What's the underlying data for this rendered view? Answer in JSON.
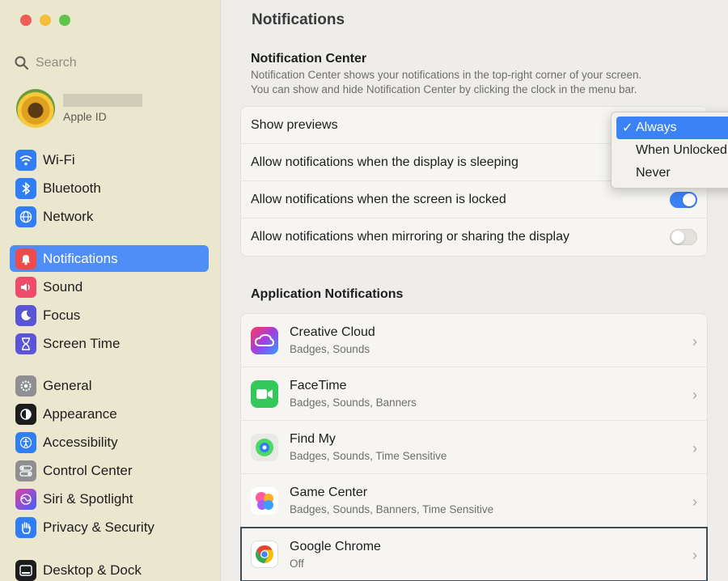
{
  "search": {
    "placeholder": "Search"
  },
  "profile": {
    "apple_id_label": "Apple ID"
  },
  "sidebar": {
    "group1": [
      {
        "label": "Wi-Fi",
        "icon": "wifi-icon",
        "color": "#2f7ef6"
      },
      {
        "label": "Bluetooth",
        "icon": "bluetooth-icon",
        "color": "#2f7ef6"
      },
      {
        "label": "Network",
        "icon": "globe-icon",
        "color": "#2f7ef6"
      }
    ],
    "group2": [
      {
        "label": "Notifications",
        "icon": "bell-icon",
        "color": "#ef4b4b",
        "active": true
      },
      {
        "label": "Sound",
        "icon": "speaker-icon",
        "color": "#ef4b6b"
      },
      {
        "label": "Focus",
        "icon": "moon-icon",
        "color": "#5a55d6"
      },
      {
        "label": "Screen Time",
        "icon": "hourglass-icon",
        "color": "#5a55d6"
      }
    ],
    "group3": [
      {
        "label": "General",
        "icon": "gear-icon",
        "color": "#8e8e93"
      },
      {
        "label": "Appearance",
        "icon": "appearance-icon",
        "color": "#1d1d1f"
      },
      {
        "label": "Accessibility",
        "icon": "accessibility-icon",
        "color": "#2f7ef6"
      },
      {
        "label": "Control Center",
        "icon": "control-center-icon",
        "color": "#8e8e93"
      },
      {
        "label": "Siri & Spotlight",
        "icon": "siri-icon",
        "color": "#7a4ee0"
      },
      {
        "label": "Privacy & Security",
        "icon": "hand-icon",
        "color": "#2f7ef6"
      }
    ],
    "group4": [
      {
        "label": "Desktop & Dock",
        "icon": "dock-icon",
        "color": "#1d1d1f"
      }
    ]
  },
  "main": {
    "title": "Notifications",
    "nc_title": "Notification Center",
    "nc_desc_line1": "Notification Center shows your notifications in the top-right corner of your screen.",
    "nc_desc_line2": "You can show and hide Notification Center by clicking the clock in the menu bar.",
    "settings": [
      {
        "label": "Show previews",
        "control": "popup"
      },
      {
        "label": "Allow notifications when the display is sleeping",
        "control": "none"
      },
      {
        "label": "Allow notifications when the screen is locked",
        "control": "toggle",
        "on": true
      },
      {
        "label": "Allow notifications when mirroring or sharing the display",
        "control": "toggle",
        "on": false
      }
    ],
    "app_section_title": "Application Notifications",
    "apps": [
      {
        "name": "Creative Cloud",
        "sub": "Badges, Sounds",
        "icon": "creative-cloud-icon"
      },
      {
        "name": "FaceTime",
        "sub": "Badges, Sounds, Banners",
        "icon": "facetime-icon"
      },
      {
        "name": "Find My",
        "sub": "Badges, Sounds, Time Sensitive",
        "icon": "find-my-icon"
      },
      {
        "name": "Game Center",
        "sub": "Badges, Sounds, Banners, Time Sensitive",
        "icon": "game-center-icon"
      },
      {
        "name": "Google Chrome",
        "sub": "Off",
        "icon": "chrome-icon",
        "highlighted": true
      }
    ]
  },
  "popup": {
    "options": [
      "Always",
      "When Unlocked",
      "Never"
    ],
    "selected": "Always",
    "check": "✓"
  }
}
